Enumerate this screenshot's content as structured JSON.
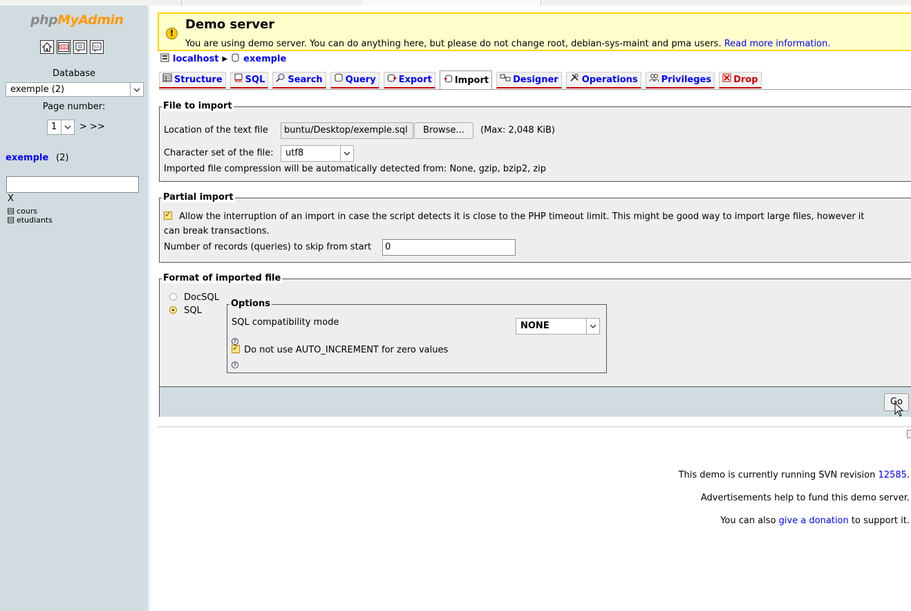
{
  "left": {
    "logo_part1": "php",
    "logo_part2": "MyAdmin",
    "database_label": "Database",
    "database_select": "exemple (2)",
    "page_number_label": "Page number:",
    "page_number_value": "1",
    "page_next": "> >>",
    "db_link": "exemple",
    "db_count": "(2)",
    "filter_clear": "X",
    "tables": [
      "cours",
      "etudiants"
    ]
  },
  "notice": {
    "title": "Demo server",
    "message": "You are using demo server. You can do anything here, but please do not change root, debian-sys-maint and pma users.",
    "link": "Read more information."
  },
  "breadcrumb": {
    "server": "localhost",
    "database": "exemple"
  },
  "tabs": [
    "Structure",
    "SQL",
    "Search",
    "Query",
    "Export",
    "Import",
    "Designer",
    "Operations",
    "Privileges",
    "Drop"
  ],
  "active_tab": "Import",
  "file_import": {
    "legend": "File to import",
    "location_label": "Location of the text file",
    "file_value": "buntu/Desktop/exemple.sql",
    "browse_label": "Browse...",
    "max_size": "(Max: 2,048 KiB)",
    "charset_label": "Character set of the file:",
    "charset_value": "utf8",
    "compression_note": "Imported file compression will be automatically detected from: None, gzip, bzip2, zip"
  },
  "partial_import": {
    "legend": "Partial import",
    "allow_interrupt_line1": "Allow the interruption of an import in case the script detects it is close to the PHP timeout limit. This might be good way to import large files, however it",
    "allow_interrupt_line2": "can break transactions.",
    "skip_label": "Number of records (queries) to skip from start",
    "skip_value": "0"
  },
  "format": {
    "legend": "Format of imported file",
    "formats": [
      "DocSQL",
      "SQL"
    ],
    "selected_format": "SQL",
    "options_legend": "Options",
    "compat_label": "SQL compatibility mode",
    "compat_value": "NONE",
    "no_auto_increment_label": "Do not use AUTO_INCREMENT for zero values",
    "go_label": "Go"
  },
  "footer": {
    "svn_prefix": "This demo is currently running SVN revision",
    "svn_revision": "12585",
    "svn_suffix": ".",
    "ads": "Advertisements help to fund this demo server.",
    "donate_prefix": "You can also",
    "donate_link": "give a donation",
    "donate_suffix": "to support it."
  },
  "colors": {
    "nav_bg": "#d0dce0",
    "notice_bg": "#ffffcc",
    "notice_border": "#ffd700",
    "link": "#0000ff",
    "tab_underline": "#cc0000"
  },
  "icons": {
    "home": "home-icon",
    "query_window": "sql-query-window-icon",
    "docs": "documentation-icon",
    "sql_docs": "sql-documentation-icon"
  }
}
